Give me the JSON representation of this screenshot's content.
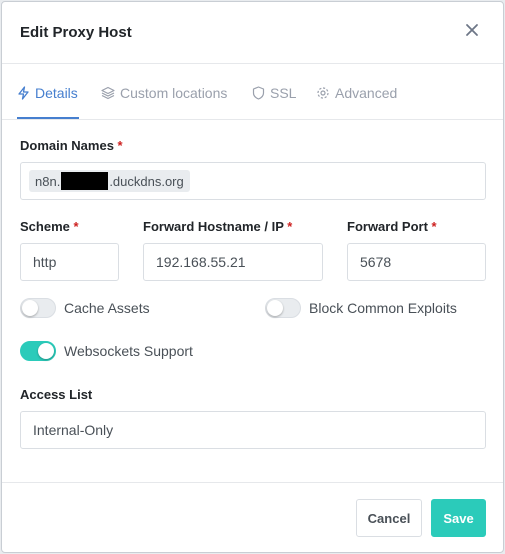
{
  "dialog": {
    "title": "Edit Proxy Host"
  },
  "tabs": [
    {
      "label": "Details",
      "icon": "bolt-icon",
      "active": true
    },
    {
      "label": "Custom locations",
      "icon": "layers-icon",
      "active": false
    },
    {
      "label": "SSL",
      "icon": "shield-icon",
      "active": false
    },
    {
      "label": "Advanced",
      "icon": "gear-icon",
      "active": false
    }
  ],
  "form": {
    "domain_names": {
      "label": "Domain Names",
      "required_mark": "*",
      "chip_prefix": "n8n.",
      "chip_suffix": ".duckdns.org"
    },
    "scheme": {
      "label": "Scheme",
      "required_mark": "*",
      "value": "http"
    },
    "forward_host": {
      "label": "Forward Hostname / IP",
      "required_mark": "*",
      "value": "192.168.55.21"
    },
    "forward_port": {
      "label": "Forward Port",
      "required_mark": "*",
      "value": "5678"
    },
    "cache_assets": {
      "label": "Cache Assets",
      "enabled": false
    },
    "block_exploits": {
      "label": "Block Common Exploits",
      "enabled": false
    },
    "websockets": {
      "label": "Websockets Support",
      "enabled": true
    },
    "access_list": {
      "label": "Access List",
      "value": "Internal-Only"
    }
  },
  "footer": {
    "cancel_label": "Cancel",
    "save_label": "Save"
  },
  "colors": {
    "accent": "#467fcf",
    "toggle_on": "#2bcbba",
    "required": "#cd201f"
  }
}
